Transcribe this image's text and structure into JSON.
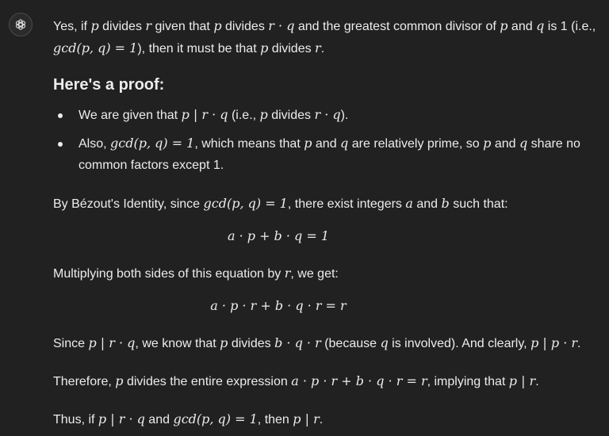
{
  "para1": {
    "l1a": "Yes, if ",
    "l1b": "p",
    "l1c": " divides ",
    "l1d": "r",
    "l1e": " given that ",
    "l1f": "p",
    "l1g": " divides ",
    "l1h": "r · q",
    "l1i": " and the greatest common divisor of ",
    "l1j": "p",
    "l1k": " and ",
    "l1l": "q",
    "l1m": " is 1 (i.e.,",
    "l2a": "gcd(p, q) = 1",
    "l2b": "), then it must be that ",
    "l2c": "p",
    "l2d": " divides ",
    "l2e": "r",
    "l2f": "."
  },
  "heading": "Here's a proof:",
  "bullet1": {
    "a": "We are given that ",
    "b": "p | r · q",
    "c": " (i.e., ",
    "d": "p",
    "e": " divides ",
    "f": "r · q",
    "g": ")."
  },
  "bullet2": {
    "a": "Also, ",
    "b": "gcd(p, q) = 1",
    "c": ", which means that ",
    "d": "p",
    "e": " and ",
    "f": "q",
    "g": " are relatively prime, so ",
    "h": "p",
    "i": " and ",
    "j": "q",
    "k": " share no",
    "l2": "common factors except 1."
  },
  "bezout": {
    "a": "By Bézout's Identity, since ",
    "b": "gcd(p, q) = 1",
    "c": ", there exist integers ",
    "d": "a",
    "e": " and ",
    "f": "b",
    "g": " such that:"
  },
  "eq1": "a · p + b · q = 1",
  "mult": {
    "a": "Multiplying both sides of this equation by ",
    "b": "r",
    "c": ", we get:"
  },
  "eq2": "a · p · r + b · q · r = r",
  "since": {
    "a": "Since ",
    "b": "p | r · q",
    "c": ", we know that ",
    "d": "p",
    "e": " divides ",
    "f": "b · q · r",
    "g": " (because ",
    "h": "q",
    "i": " is involved). And clearly, ",
    "j": "p | p · r",
    "k": "."
  },
  "therefore": {
    "a": "Therefore, ",
    "b": "p",
    "c": " divides the entire expression ",
    "d": "a · p · r + b · q · r = r",
    "e": ", implying that ",
    "f": "p | r",
    "g": "."
  },
  "thus": {
    "a": "Thus, if ",
    "b": "p | r · q",
    "c": " and ",
    "d": "gcd(p, q) = 1",
    "e": ", then ",
    "f": "p | r",
    "g": "."
  }
}
